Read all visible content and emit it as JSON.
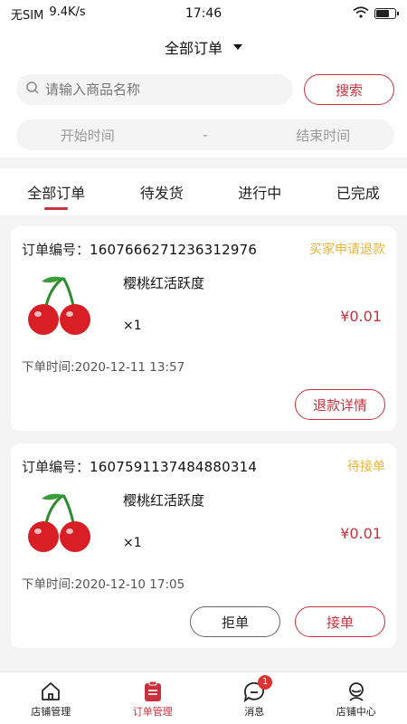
{
  "status_bar": {
    "carrier": "无SIM",
    "speed": "9.4K/s",
    "time": "17:46"
  },
  "header": {
    "title": "全部订单"
  },
  "search": {
    "placeholder": "请输入商品名称",
    "button_label": "搜索"
  },
  "date_filter": {
    "start": "开始时间",
    "separator": "-",
    "end": "结束时间"
  },
  "tabs": [
    {
      "label": "全部订单",
      "active": true
    },
    {
      "label": "待发货",
      "active": false
    },
    {
      "label": "进行中",
      "active": false
    },
    {
      "label": "已完成",
      "active": false
    }
  ],
  "orders": [
    {
      "order_label": "订单编号：",
      "order_no": "1607666271236312976",
      "status": "买家申请退款",
      "product_name": "樱桃红活跃度",
      "qty": "×1",
      "price": "¥0.01",
      "time_label": "下单时间:",
      "time": "2020-12-11 13:57",
      "actions": [
        "退款详情"
      ]
    },
    {
      "order_label": "订单编号：",
      "order_no": "1607591137484880314",
      "status": "待接单",
      "product_name": "樱桃红活跃度",
      "qty": "×1",
      "price": "¥0.01",
      "time_label": "下单时间:",
      "time": "2020-12-10 17:05",
      "actions": [
        "拒单",
        "接单"
      ]
    }
  ],
  "bottom_nav": [
    {
      "label": "店铺管理",
      "icon": "home-icon"
    },
    {
      "label": "订单管理",
      "icon": "order-icon",
      "active": true
    },
    {
      "label": "消息",
      "icon": "message-icon",
      "badge": "1"
    },
    {
      "label": "店铺中心",
      "icon": "shop-center-icon"
    }
  ],
  "colors": {
    "accent": "#c8323c",
    "pending": "#e5b43a",
    "background": "#f4f4f4"
  }
}
